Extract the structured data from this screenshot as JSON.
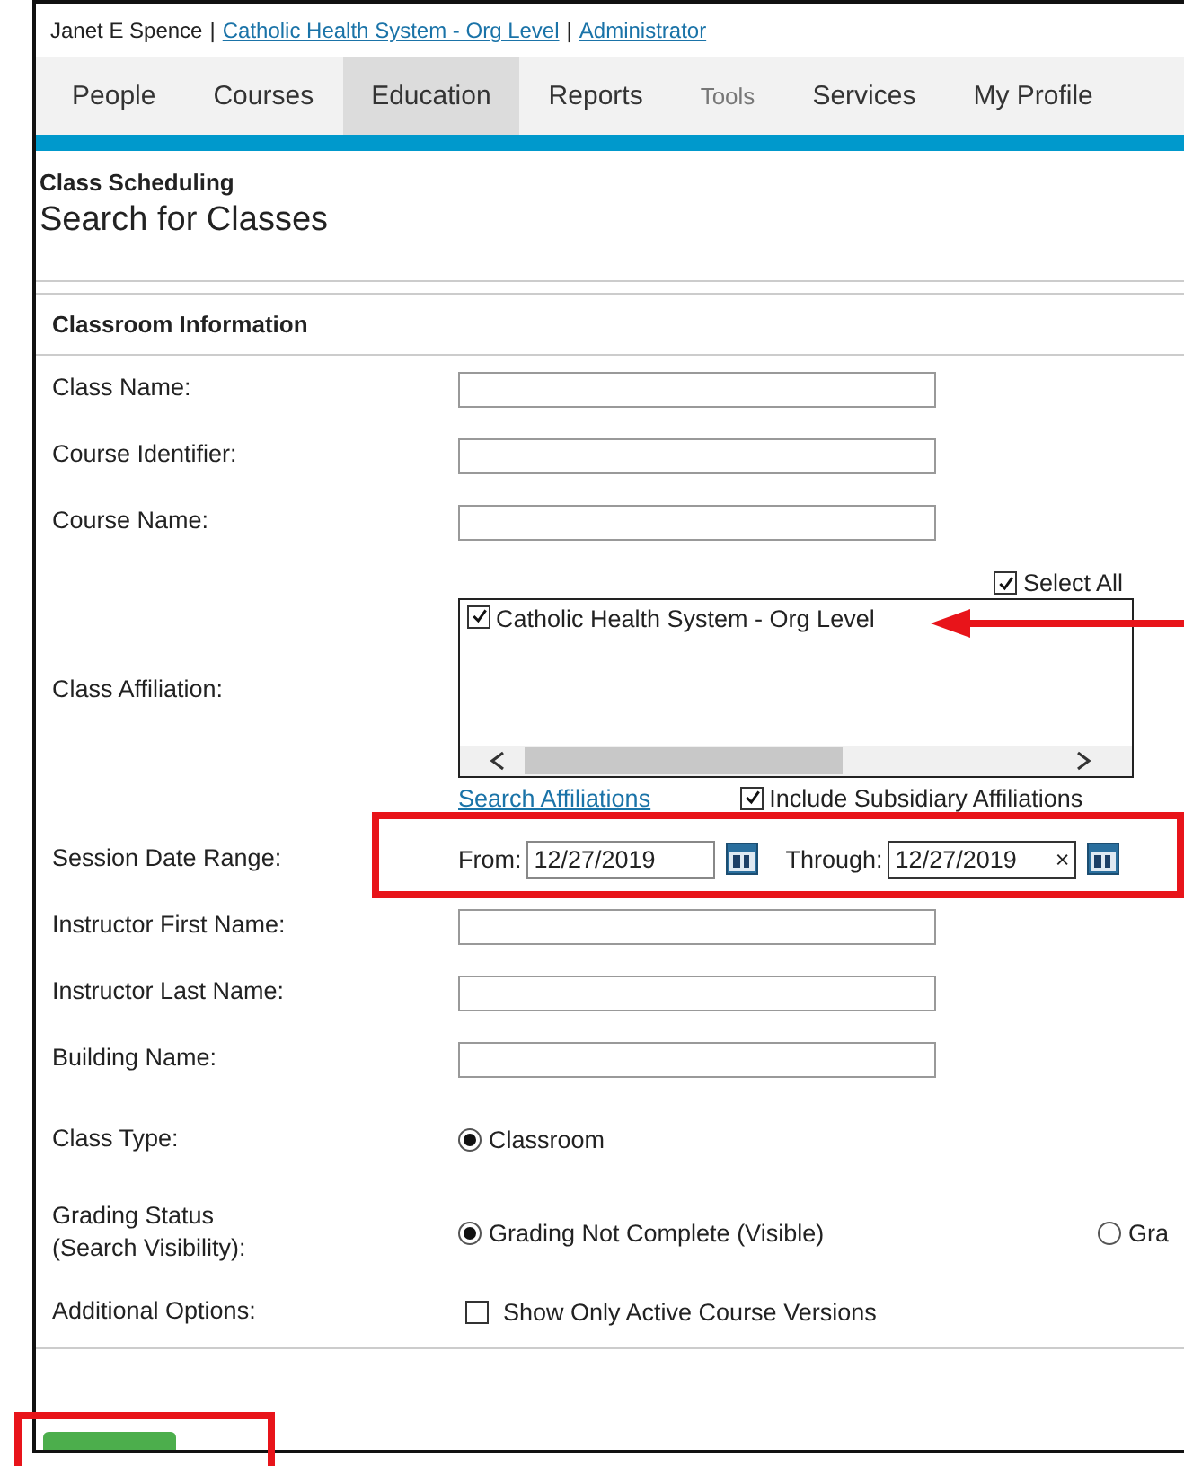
{
  "user_bar": [
    {
      "kind": "text",
      "text": "Janet E Spence"
    },
    {
      "kind": "sep",
      "text": "|"
    },
    {
      "kind": "link",
      "text": "Catholic Health System - Org Level"
    },
    {
      "kind": "sep",
      "text": "|"
    },
    {
      "kind": "link",
      "text": "Administrator"
    }
  ],
  "nav": {
    "tabs": [
      {
        "label": "People",
        "selected": false,
        "disabled": false
      },
      {
        "label": "Courses",
        "selected": false,
        "disabled": false
      },
      {
        "label": "Education",
        "selected": true,
        "disabled": false
      },
      {
        "label": "Reports",
        "selected": false,
        "disabled": false
      },
      {
        "label": "Tools",
        "selected": false,
        "disabled": true
      },
      {
        "label": "Services",
        "selected": false,
        "disabled": false
      },
      {
        "label": "My Profile",
        "selected": false,
        "disabled": false
      }
    ]
  },
  "page": {
    "section": "Class Scheduling",
    "title": "Search for Classes"
  },
  "form": {
    "heading": "Classroom Information",
    "rows": [
      {
        "kind": "text",
        "label": "Class Name:"
      },
      {
        "kind": "text",
        "label": "Course Identifier:"
      },
      {
        "kind": "text",
        "label": "Course Name:"
      },
      {
        "kind": "affiliation",
        "label": "Class Affiliation:",
        "select_all": {
          "label": "Select All",
          "checked": true
        },
        "items": [
          {
            "label": "Catholic Health System - Org Level",
            "checked": true
          }
        ],
        "link": "Search Affiliations",
        "include": {
          "label": "Include Subsidiary Affiliations",
          "checked": true
        }
      },
      {
        "kind": "date_range",
        "label": "Session Date Range:",
        "from": {
          "label": "From:",
          "value": "12/27/2019"
        },
        "through": {
          "label": "Through:",
          "value": "12/27/2019",
          "clear": "×"
        }
      },
      {
        "kind": "text",
        "label": "Instructor First Name:"
      },
      {
        "kind": "text",
        "label": "Instructor Last Name:"
      },
      {
        "kind": "text",
        "label": "Building Name:"
      },
      {
        "kind": "radio",
        "label": "Class Type:",
        "options": [
          {
            "label": "Classroom",
            "selected": true
          }
        ]
      },
      {
        "kind": "radio",
        "label": "Grading Status\n(Search Visibility):",
        "options": [
          {
            "label": "Grading Not Complete (Visible)",
            "selected": true
          },
          {
            "label": "Gra",
            "selected": false
          }
        ]
      },
      {
        "kind": "checkbox",
        "label": "Additional Options:",
        "options": [
          {
            "label": "Show Only Active Course Versions",
            "checked": false
          }
        ]
      }
    ]
  },
  "actions": [
    {
      "kind": "primary"
    }
  ]
}
